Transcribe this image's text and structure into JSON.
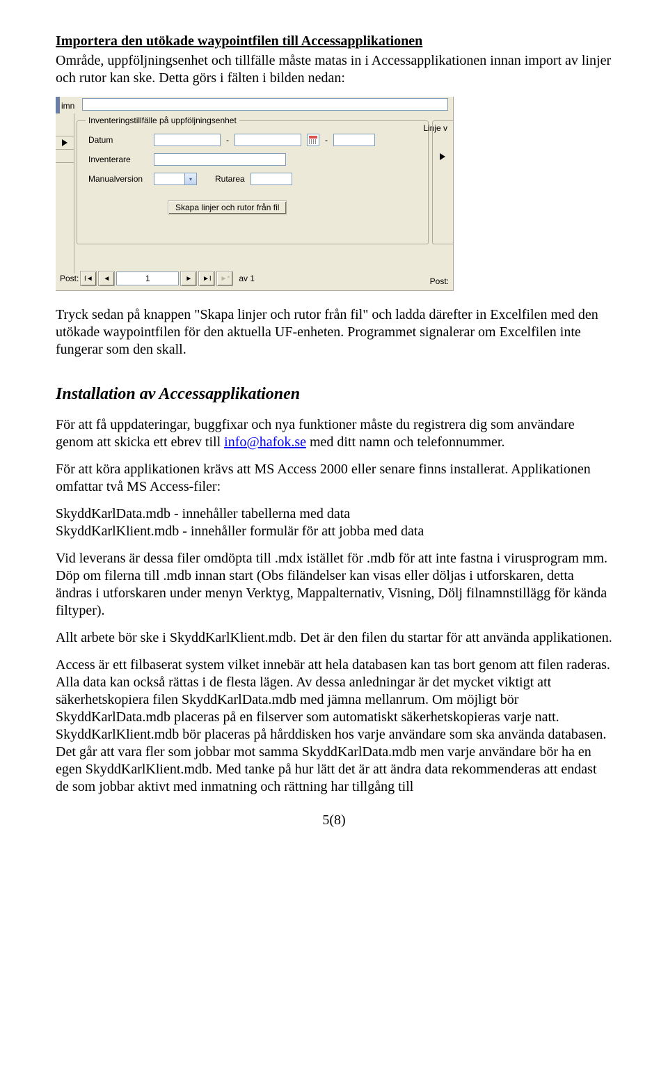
{
  "doc": {
    "h1": "Importera den utökade waypointfilen till Accessapplikationen",
    "p1": "Område, uppföljningsenhet och tillfälle måste matas in i Accessapplikationen innan import av linjer och rutor kan ske. Detta görs i fälten i bilden nedan:",
    "p2": "Tryck sedan på knappen \"Skapa linjer och rutor från fil\" och ladda därefter in Excelfilen med den utökade waypointfilen för den aktuella UF-enheten. Programmet signalerar om Excelfilen inte fungerar som den skall.",
    "h2": "Installation av Accessapplikationen",
    "p3a": "För att få uppdateringar, buggfixar och nya funktioner måste du registrera dig som användare genom att skicka ett ebrev till ",
    "mail": "info@hafok.se",
    "p3b": " med ditt namn och telefonnummer.",
    "p4": "För att köra applikationen krävs att MS Access 2000 eller senare finns installerat. Applikationen omfattar två MS Access-filer:",
    "p5a": "SkyddKarlData.mdb - innehåller tabellerna med data",
    "p5b": "SkyddKarlKlient.mdb - innehåller formulär för att jobba med data",
    "p6": "Vid leverans är dessa filer omdöpta till .mdx istället för .mdb för att inte fastna i virusprogram mm. Döp om filerna till .mdb innan start (Obs filändelser kan visas eller döljas i utforskaren, detta ändras i utforskaren under menyn Verktyg, Mappalternativ, Visning, Dölj filnamnstillägg för kända filtyper).",
    "p7": "Allt arbete bör ske i SkyddKarlKlient.mdb. Det är den filen du startar för att använda applikationen.",
    "p8": "Access är ett filbaserat system vilket innebär att hela databasen kan tas bort genom att filen raderas. Alla data kan också rättas i de flesta lägen. Av dessa anledningar är det mycket viktigt att säkerhetskopiera filen SkyddKarlData.mdb med jämna mellanrum. Om möjligt bör SkyddKarlData.mdb placeras på en filserver som automatiskt säkerhetskopieras varje natt. SkyddKarlKlient.mdb bör placeras på hårddisken hos varje användare som ska använda databasen. Det går att vara fler som jobbar mot samma SkyddKarlData.mdb men varje användare bör ha en egen SkyddKarlKlient.mdb. Med tanke på hur lätt det är att ändra data rekommenderas att endast de som jobbar aktivt med inmatning och rättning har tillgång till",
    "pagefoot": "5(8)"
  },
  "form": {
    "imn": "imn",
    "legend": "Inventeringstillfälle på uppföljningsenhet",
    "datum": "Datum",
    "dash": "-",
    "inventerare": "Inventerare",
    "manual": "Manualversion",
    "rutarea": "Rutarea",
    "linje_legend": "Linje v",
    "skapa_btn": "Skapa linjer och rutor från fil",
    "nav_post": "Post:",
    "nav_curr": "1",
    "nav_av": "av 1",
    "arrow": "▾",
    "first": "I◄",
    "prev": "◄",
    "next": "►",
    "last": "►I",
    "new": "►*"
  }
}
